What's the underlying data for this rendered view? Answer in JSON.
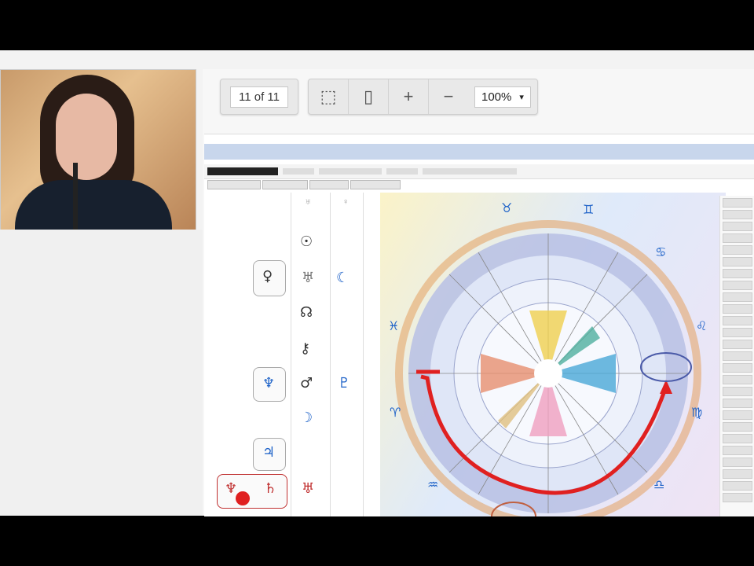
{
  "viewer": {
    "page_indicator": "11 of 11",
    "zoom_level": "100%"
  },
  "toolbar": {
    "buttons": [
      {
        "name": "fit-width",
        "icon": "fit-width-icon",
        "glyph": "⬚"
      },
      {
        "name": "fit-page",
        "icon": "fit-page-icon",
        "glyph": "▯"
      },
      {
        "name": "zoom-in",
        "icon": "plus-icon",
        "glyph": "+"
      },
      {
        "name": "zoom-out",
        "icon": "minus-icon",
        "glyph": "−"
      }
    ],
    "dropdown_icon": "▾"
  },
  "document": {
    "table_glyphs": {
      "sun": "☉",
      "venus": "♀",
      "uranus": "♅",
      "moon_sym": "☾",
      "node": "☊",
      "chiron": "⚷",
      "neptune_box": "♆",
      "mars": "♂",
      "pluto": "♇",
      "moon": "☽",
      "jupiter": "♃",
      "neptune": "♆",
      "saturn": "♄",
      "uranus2": "♅"
    },
    "zodiac_glyphs": {
      "top": "♉",
      "top_right": "♊",
      "right_upper": "♋",
      "right": "♌",
      "right_lower": "♍",
      "bottom_right": "♎",
      "bottom": "♏",
      "left_lower": "♑",
      "left": "♓",
      "left_mid": "♈",
      "left_bottom": "♒"
    }
  },
  "colors": {
    "accent_red": "#e02020",
    "outline_blue": "#4a5aa8",
    "glyph_blue": "#1e62c8",
    "glyph_red": "#c03030"
  }
}
